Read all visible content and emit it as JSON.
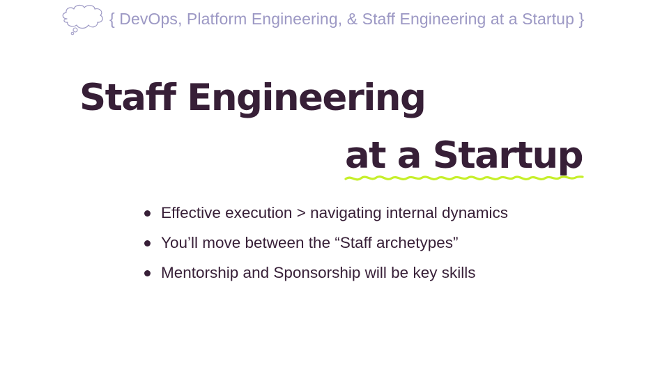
{
  "header": {
    "text": "{ DevOps, Platform Engineering, & Staff Engineering at a Startup }",
    "icon": "thought-cloud-icon",
    "color": "#9c98c4"
  },
  "title": {
    "line1": "Staff Engineering",
    "line2": "at a Startup",
    "color": "#371f37",
    "underline_color": "#c6ef2a"
  },
  "bullets": [
    "Effective execution > navigating internal dynamics",
    "You’ll move between the “Staff archetypes”",
    "Mentorship and Sponsorship will be key skills"
  ]
}
